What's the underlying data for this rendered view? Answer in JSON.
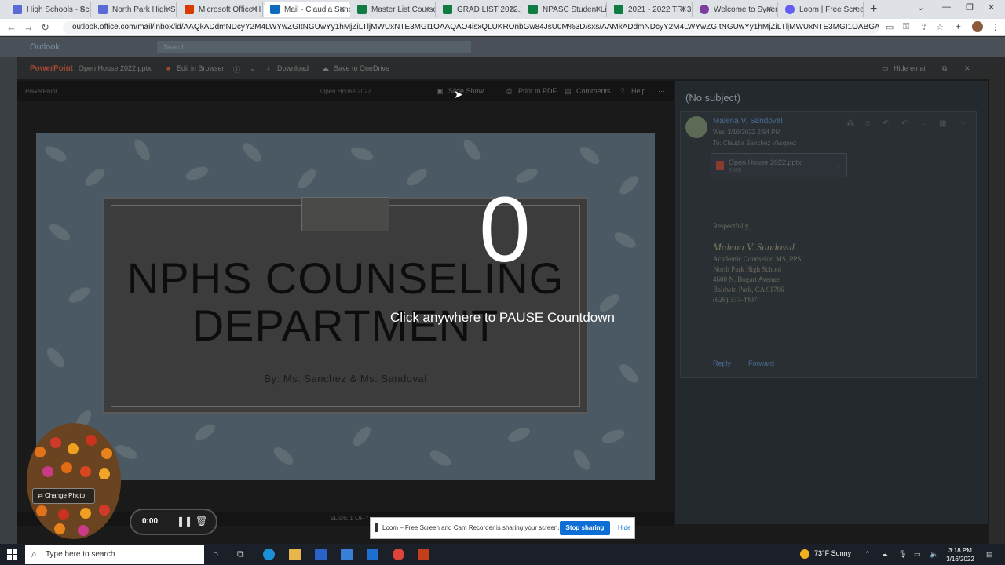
{
  "browser": {
    "tabs": [
      {
        "title": "High Schools - Sch",
        "color": "#5a6ad6"
      },
      {
        "title": "North Park High Sc",
        "color": "#5a6ad6"
      },
      {
        "title": "Microsoft Office H",
        "color": "#d83b01"
      },
      {
        "title": "Mail - Claudia Sanc",
        "color": "#0f6cbd"
      },
      {
        "title": "Master List Course",
        "color": "#107c41"
      },
      {
        "title": "GRAD LIST 2022.xl",
        "color": "#107c41"
      },
      {
        "title": "NPASC Student Lis",
        "color": "#107c41"
      },
      {
        "title": "2021 - 2022 TRI 3",
        "color": "#107c41"
      },
      {
        "title": "Welcome to Syner",
        "color": "#7b3fa0"
      },
      {
        "title": "Loom | Free Screen",
        "color": "#625df5"
      }
    ],
    "active_tab": 3,
    "new_tab": "+",
    "url": "outlook.office.com/mail/inbox/id/AAQkADdmNDcyY2M4LWYwZGItNGUwYy1hMjZiLTljMWUxNTE3MGI1OAAQAO4isxQLUKROnbGw84JsU0M%3D/sxs/AAMkADdmNDcyY2M4LWYwZGItNGUwYy1hMjZiLTljMWUxNTE3MGI1OABGAAAAAABF2v0U5%2..."
  },
  "outlook": {
    "brand": "Outlook",
    "search_placeholder": "Search"
  },
  "viewer": {
    "app": "PowerPoint",
    "file": "Open House 2022.pptx",
    "edit": "Edit in Browser",
    "download": "Download",
    "save": "Save to OneDrive",
    "hide_email": "Hide email",
    "app_label": "PowerPoint",
    "doc_title": "Open House 2022",
    "slideshow": "Slide Show",
    "print": "Print to PDF",
    "comments": "Comments",
    "help": "Help",
    "slide_counter": "SLIDE 1 OF 7"
  },
  "slide": {
    "title_line1": "NPHS COUNSELING",
    "title_line2": "DEPARTMENT",
    "subtitle": "By: Ms. Sanchez & Ms. Sandoval"
  },
  "countdown": {
    "number": "0",
    "message": "Click anywhere to PAUSE Countdown"
  },
  "mail": {
    "subject": "(No subject)",
    "sender": "Malena V. Sandoval",
    "sent": "Wed 3/16/2022 2:54 PM",
    "to": "To: Claudia Sanchez Vasquez",
    "attachment_name": "Open House 2022.pptx",
    "attachment_size": "3 MB",
    "closing": "Respectfully,",
    "sig_name": "Malena V. Sandoval",
    "sig_lines": [
      "Academic Counselor, MS, PPS",
      "North Park High School",
      "4600 N. Bogart Avenue",
      "Baldwin Park, CA 91706",
      "(626) 337-4407"
    ],
    "reply": "Reply",
    "forward": "Forward"
  },
  "recorder": {
    "change_photo": "Change Photo",
    "time": "0:00"
  },
  "loom": {
    "message": "Loom – Free Screen and Cam Recorder is sharing your screen.",
    "stop": "Stop sharing",
    "hide": "Hide"
  },
  "taskbar": {
    "search_placeholder": "Type here to search",
    "weather": "73°F  Sunny",
    "time": "3:18 PM",
    "date": "3/16/2022"
  }
}
